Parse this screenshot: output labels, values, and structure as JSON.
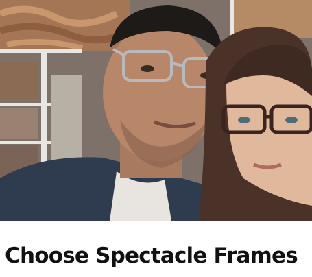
{
  "hero": {
    "image_icon": "photo-of-couple-wearing-glasses",
    "colors": {
      "background_wall": "#8a7a6c",
      "wood_pattern": "#b0805a",
      "frame_white": "#e8e6e2",
      "man_skin": "#b8876a",
      "woman_hair": "#4a3228",
      "woman_skin": "#e0b89c",
      "sweater_navy": "#2f3b4e"
    }
  },
  "title": "Choose Spectacle Frames"
}
